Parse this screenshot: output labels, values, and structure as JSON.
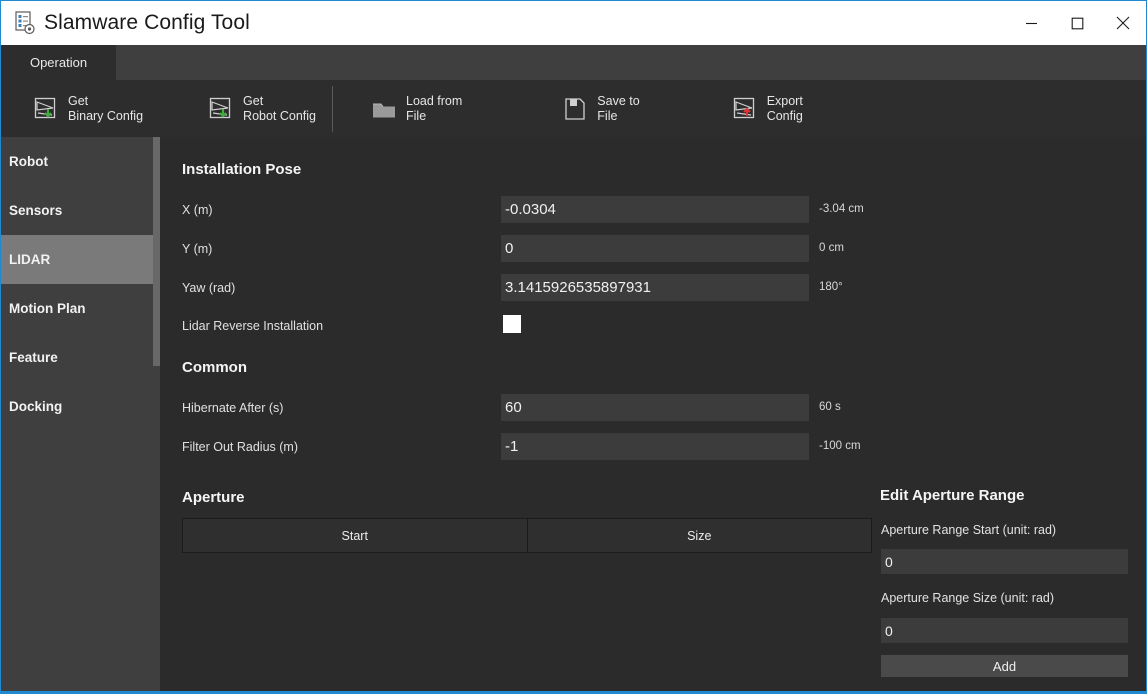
{
  "window": {
    "title": "Slamware Config Tool",
    "app_icon": "document-gear-icon",
    "minimize_label": "—",
    "maximize_label": "□",
    "close_label": "✕",
    "accent_color": "#1f8ad2",
    "titlebar_bg": "#ffffff"
  },
  "tabs": [
    {
      "label": "Operation",
      "active": true
    }
  ],
  "toolbar": {
    "items": [
      {
        "label": "Get\nBinary Config",
        "icon": "download-config-icon",
        "badge_color": "#3fae3f"
      },
      {
        "label": "Get\nRobot Config",
        "icon": "download-config-icon",
        "badge_color": "#3fae3f"
      },
      {
        "label": "Load from\nFile",
        "icon": "folder-open-icon",
        "badge_color": ""
      },
      {
        "label": "Save to\nFile",
        "icon": "floppy-disk-icon",
        "badge_color": ""
      },
      {
        "label": "Export\nConfig",
        "icon": "upload-config-icon",
        "badge_color": "#e03434"
      }
    ]
  },
  "sidebar": {
    "items": [
      {
        "label": "Robot",
        "active": false
      },
      {
        "label": "Sensors",
        "active": false
      },
      {
        "label": "LIDAR",
        "active": true
      },
      {
        "label": "Motion Plan",
        "active": false
      },
      {
        "label": "Feature",
        "active": false
      },
      {
        "label": "Docking",
        "active": false
      }
    ]
  },
  "main": {
    "installation_pose": {
      "title": "Installation Pose",
      "fields": [
        {
          "label": "X (m)",
          "value": "-0.0304",
          "suffix": "-3.04 cm"
        },
        {
          "label": "Y (m)",
          "value": "0",
          "suffix": "0 cm"
        },
        {
          "label": "Yaw (rad)",
          "value": "3.1415926535897931",
          "suffix": "180°"
        }
      ],
      "checkbox": {
        "label": "Lidar Reverse Installation",
        "checked": false
      }
    },
    "common": {
      "title": "Common",
      "fields": [
        {
          "label": "Hibernate After (s)",
          "value": "60",
          "suffix": "60 s"
        },
        {
          "label": "Filter Out Radius (m)",
          "value": "-1",
          "suffix": "-100 cm"
        }
      ]
    },
    "aperture": {
      "title": "Aperture",
      "columns": [
        "Start",
        "Size"
      ],
      "rows": []
    },
    "edit_aperture_range": {
      "title": "Edit Aperture Range",
      "start_label": "Aperture Range Start (unit: rad)",
      "start_value": "0",
      "size_label": "Aperture Range Size (unit: rad)",
      "size_value": "0",
      "add_label": "Add"
    }
  }
}
